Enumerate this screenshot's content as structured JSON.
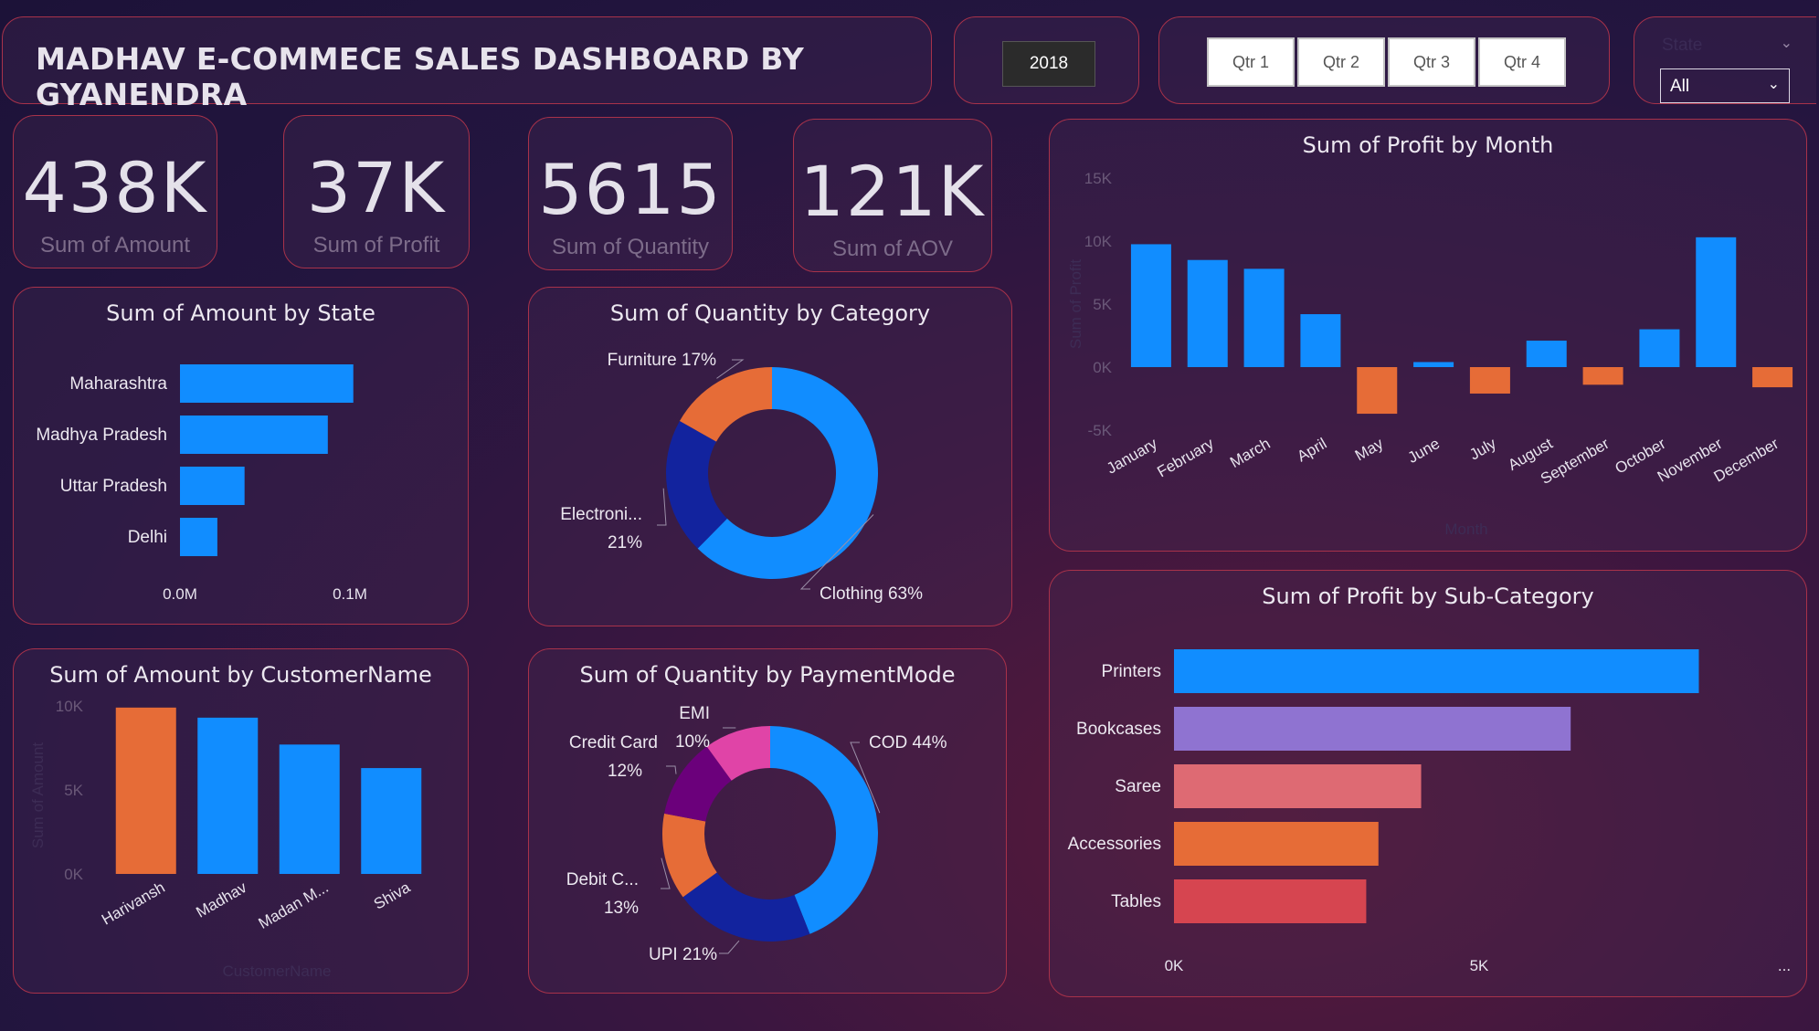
{
  "header": {
    "title": "MADHAV E-COMMECE SALES DASHBOARD BY GYANENDRA",
    "year": "2018",
    "quarters": [
      "Qtr 1",
      "Qtr 2",
      "Qtr 3",
      "Qtr 4"
    ],
    "state_label": "State",
    "state_value": "All"
  },
  "kpis": [
    {
      "value": "438K",
      "label": "Sum of Amount"
    },
    {
      "value": "37K",
      "label": "Sum of Profit"
    },
    {
      "value": "5615",
      "label": "Sum of Quantity"
    },
    {
      "value": "121K",
      "label": "Sum of AOV"
    }
  ],
  "colors": {
    "blue": "#118DFF",
    "orange": "#E66C37",
    "navy": "#12239E",
    "purple": "#6B007B",
    "pink": "#E044A7",
    "lavender": "#8F73D1",
    "coral": "#DE6A73",
    "red": "#D64550"
  },
  "icons": {
    "dropdown": "chevron-down-icon"
  },
  "chart_data": [
    {
      "id": "amount_by_state",
      "type": "bar",
      "orientation": "horizontal",
      "title": "Sum of Amount by State",
      "categories": [
        "Maharashtra",
        "Madhya Pradesh",
        "Uttar Pradesh",
        "Delhi"
      ],
      "values": [
        0.102,
        0.087,
        0.038,
        0.022
      ],
      "x_ticks": [
        "0.0M",
        "0.1M"
      ],
      "xlim": [
        0,
        0.1
      ],
      "unit": "M"
    },
    {
      "id": "quantity_by_category",
      "type": "pie",
      "donut": true,
      "title": "Sum of Quantity by Category",
      "slices": [
        {
          "name": "Clothing",
          "label": "Clothing 63%",
          "value": 63,
          "color": "#118DFF"
        },
        {
          "name": "Electronics",
          "label": "Electroni...",
          "pct": "21%",
          "value": 21,
          "color": "#12239E"
        },
        {
          "name": "Furniture",
          "label": "Furniture 17%",
          "value": 17,
          "color": "#E66C37"
        }
      ]
    },
    {
      "id": "profit_by_month",
      "type": "bar",
      "title": "Sum of Profit by Month",
      "xlabel": "Month",
      "ylabel": "Sum of Profit",
      "categories": [
        "January",
        "February",
        "March",
        "April",
        "May",
        "June",
        "July",
        "August",
        "September",
        "October",
        "November",
        "December"
      ],
      "values": [
        9750,
        8500,
        7800,
        4200,
        -3700,
        400,
        -2100,
        2100,
        -1400,
        3000,
        10300,
        -1600
      ],
      "y_ticks": [
        "15K",
        "10K",
        "5K",
        "0K",
        "-5K"
      ],
      "ylim": [
        -5000,
        15000
      ]
    },
    {
      "id": "amount_by_customer",
      "type": "bar",
      "title": "Sum of Amount by CustomerName",
      "xlabel": "CustomerName",
      "ylabel": "Sum of Amount",
      "categories": [
        "Harivansh",
        "Madhav",
        "Madan M...",
        "Shiva"
      ],
      "values": [
        9900,
        9300,
        7700,
        6300
      ],
      "y_ticks": [
        "10K",
        "5K",
        "0K"
      ],
      "ylim": [
        0,
        10000
      ]
    },
    {
      "id": "quantity_by_paymentmode",
      "type": "pie",
      "donut": true,
      "title": "Sum of Quantity by PaymentMode",
      "slices": [
        {
          "name": "COD",
          "label": "COD 44%",
          "value": 44,
          "color": "#118DFF"
        },
        {
          "name": "UPI",
          "label": "UPI 21%",
          "value": 21,
          "color": "#12239E"
        },
        {
          "name": "Debit Card",
          "label": "Debit C...",
          "pct": "13%",
          "value": 13,
          "color": "#E66C37"
        },
        {
          "name": "Credit Card",
          "label": "Credit Card",
          "pct": "12%",
          "value": 12,
          "color": "#6B007B"
        },
        {
          "name": "EMI",
          "label": "EMI",
          "pct": "10%",
          "value": 10,
          "color": "#E044A7"
        }
      ]
    },
    {
      "id": "profit_by_subcategory",
      "type": "bar",
      "orientation": "horizontal",
      "title": "Sum of Profit by Sub-Category",
      "categories": [
        "Printers",
        "Bookcases",
        "Saree",
        "Accessories",
        "Tables"
      ],
      "values": [
        8600,
        6500,
        4050,
        3350,
        3150
      ],
      "colors": [
        "#118DFF",
        "#8F73D1",
        "#DE6A73",
        "#E66C37",
        "#D64550"
      ],
      "x_ticks": [
        "0K",
        "5K",
        "..."
      ],
      "xlim": [
        0,
        5000
      ]
    }
  ]
}
